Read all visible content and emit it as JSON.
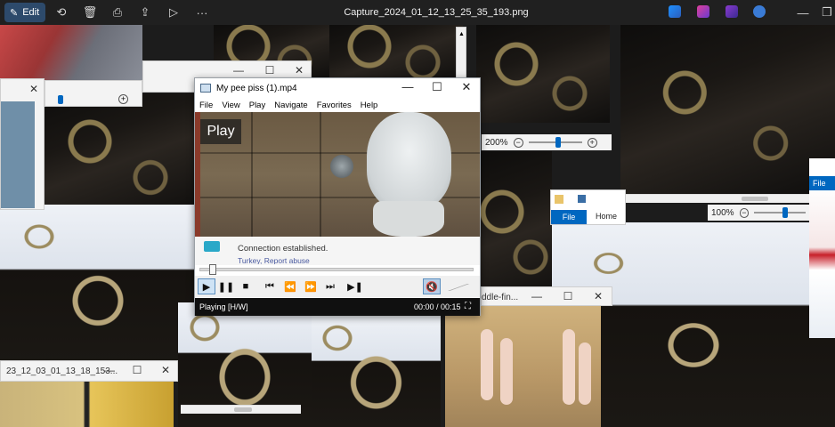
{
  "toolbar": {
    "edit_label": "Edit",
    "file_title": "Capture_2024_01_12_13_25_35_193.png",
    "icons": [
      "edit-icon",
      "rotate-icon",
      "delete-icon",
      "print-icon",
      "share-icon",
      "slideshow-icon",
      "more-icon"
    ],
    "window_controls": {
      "minimize": "—",
      "restore": "❐"
    }
  },
  "player": {
    "title": "My pee piss (1).mp4",
    "menu": [
      "File",
      "View",
      "Play",
      "Navigate",
      "Favorites",
      "Help"
    ],
    "overlay_label": "Play",
    "notification": {
      "text": "Connection established.",
      "sub": "Turkey, Report abuse"
    },
    "status_text": "Playing [H/W]",
    "time": "00:00 / 00:15"
  },
  "zoom_mid": {
    "label": "200%"
  },
  "zoom_right": {
    "label": "100%"
  },
  "ribbon": {
    "file_tab": "File",
    "home_tab": "Home"
  },
  "ribbon2": {
    "file_tab": "File"
  },
  "bottom_left_win": {
    "title": "23_12_03_01_13_18_153..."
  },
  "bottom_mid_win": {
    "title": "ddle-fin..."
  }
}
